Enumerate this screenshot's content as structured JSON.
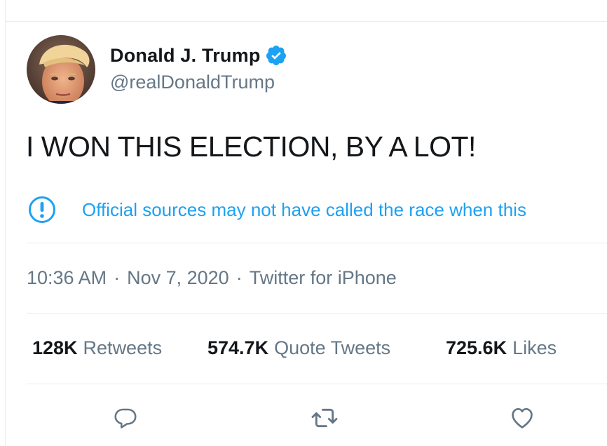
{
  "tweet": {
    "author": {
      "display_name": "Donald J. Trump",
      "handle": "@realDonaldTrump",
      "verified": true
    },
    "text": "I WON THIS ELECTION, BY A LOT!",
    "notice": {
      "icon": "exclamation-circle-icon",
      "text": "Official sources may not have called the race when this"
    },
    "meta": {
      "time": "10:36 AM",
      "separator": "·",
      "date": "Nov 7, 2020",
      "source": "Twitter for iPhone"
    },
    "stats": {
      "retweets": {
        "count": "128K",
        "label": "Retweets"
      },
      "quote_tweets": {
        "count": "574.7K",
        "label": "Quote Tweets"
      },
      "likes": {
        "count": "725.6K",
        "label": "Likes"
      }
    },
    "actions": [
      "reply-icon",
      "retweet-icon",
      "like-icon"
    ]
  },
  "colors": {
    "accent": "#1da1f2",
    "text_primary": "#14171a",
    "text_secondary": "#657786",
    "divider": "#e6ecf0"
  }
}
